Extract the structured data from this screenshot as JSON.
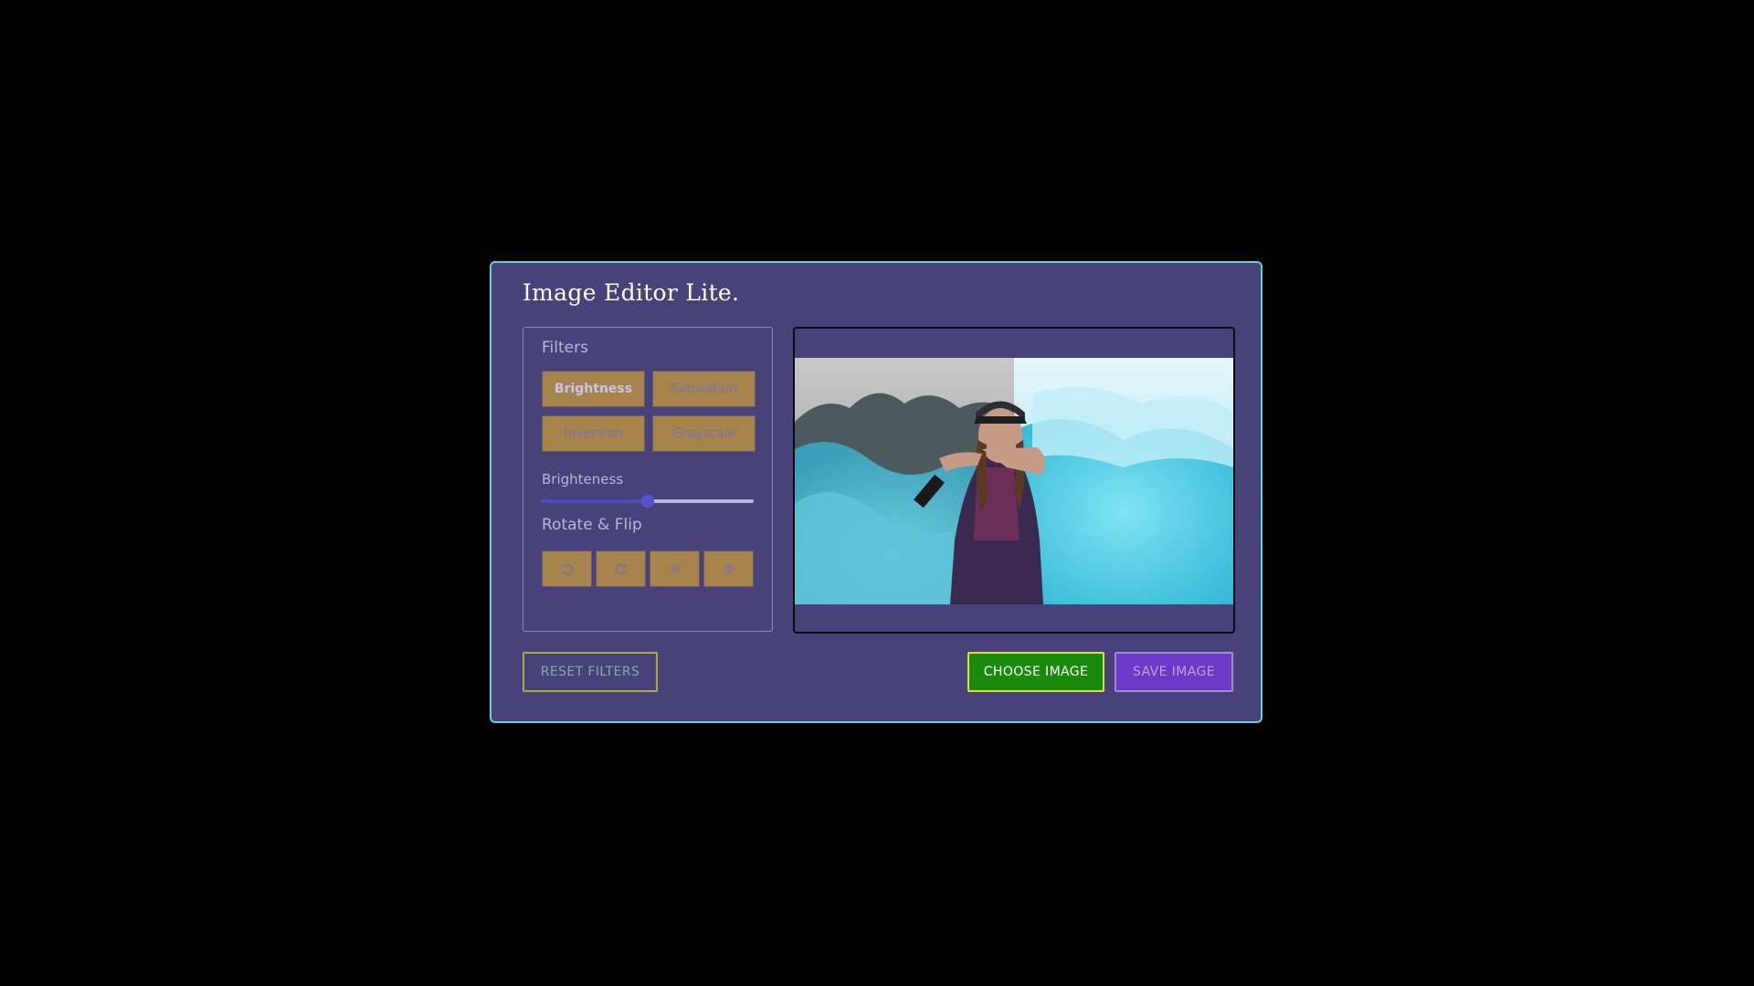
{
  "app": {
    "title": "Image Editor Lite."
  },
  "filters": {
    "heading": "Filters",
    "buttons": [
      {
        "label": "Brightness",
        "active": true
      },
      {
        "label": "Saturation",
        "active": false
      },
      {
        "label": "Inversion",
        "active": false
      },
      {
        "label": "Grayscale",
        "active": false
      }
    ],
    "slider": {
      "label": "Brighteness",
      "value_fraction": 0.5
    }
  },
  "rotate": {
    "heading": "Rotate & Flip",
    "buttons": [
      {
        "icon": "rotate-left-icon"
      },
      {
        "icon": "rotate-right-icon"
      },
      {
        "icon": "flip-horizontal-icon"
      },
      {
        "icon": "flip-vertical-icon"
      }
    ]
  },
  "preview": {
    "image": "woman with blue smoke flare, left half grayscale"
  },
  "actions": {
    "reset_label": "RESET FILTERS",
    "choose_label": "CHOOSE IMAGE",
    "save_label": "SAVE IMAGE"
  },
  "colors": {
    "background": "#000000",
    "panel": "#47427a",
    "border_accent": "#5dd3e0",
    "filter_button": "#a7844c",
    "choose_button": "#1a8a0c",
    "save_button": "#6c3ac7"
  }
}
